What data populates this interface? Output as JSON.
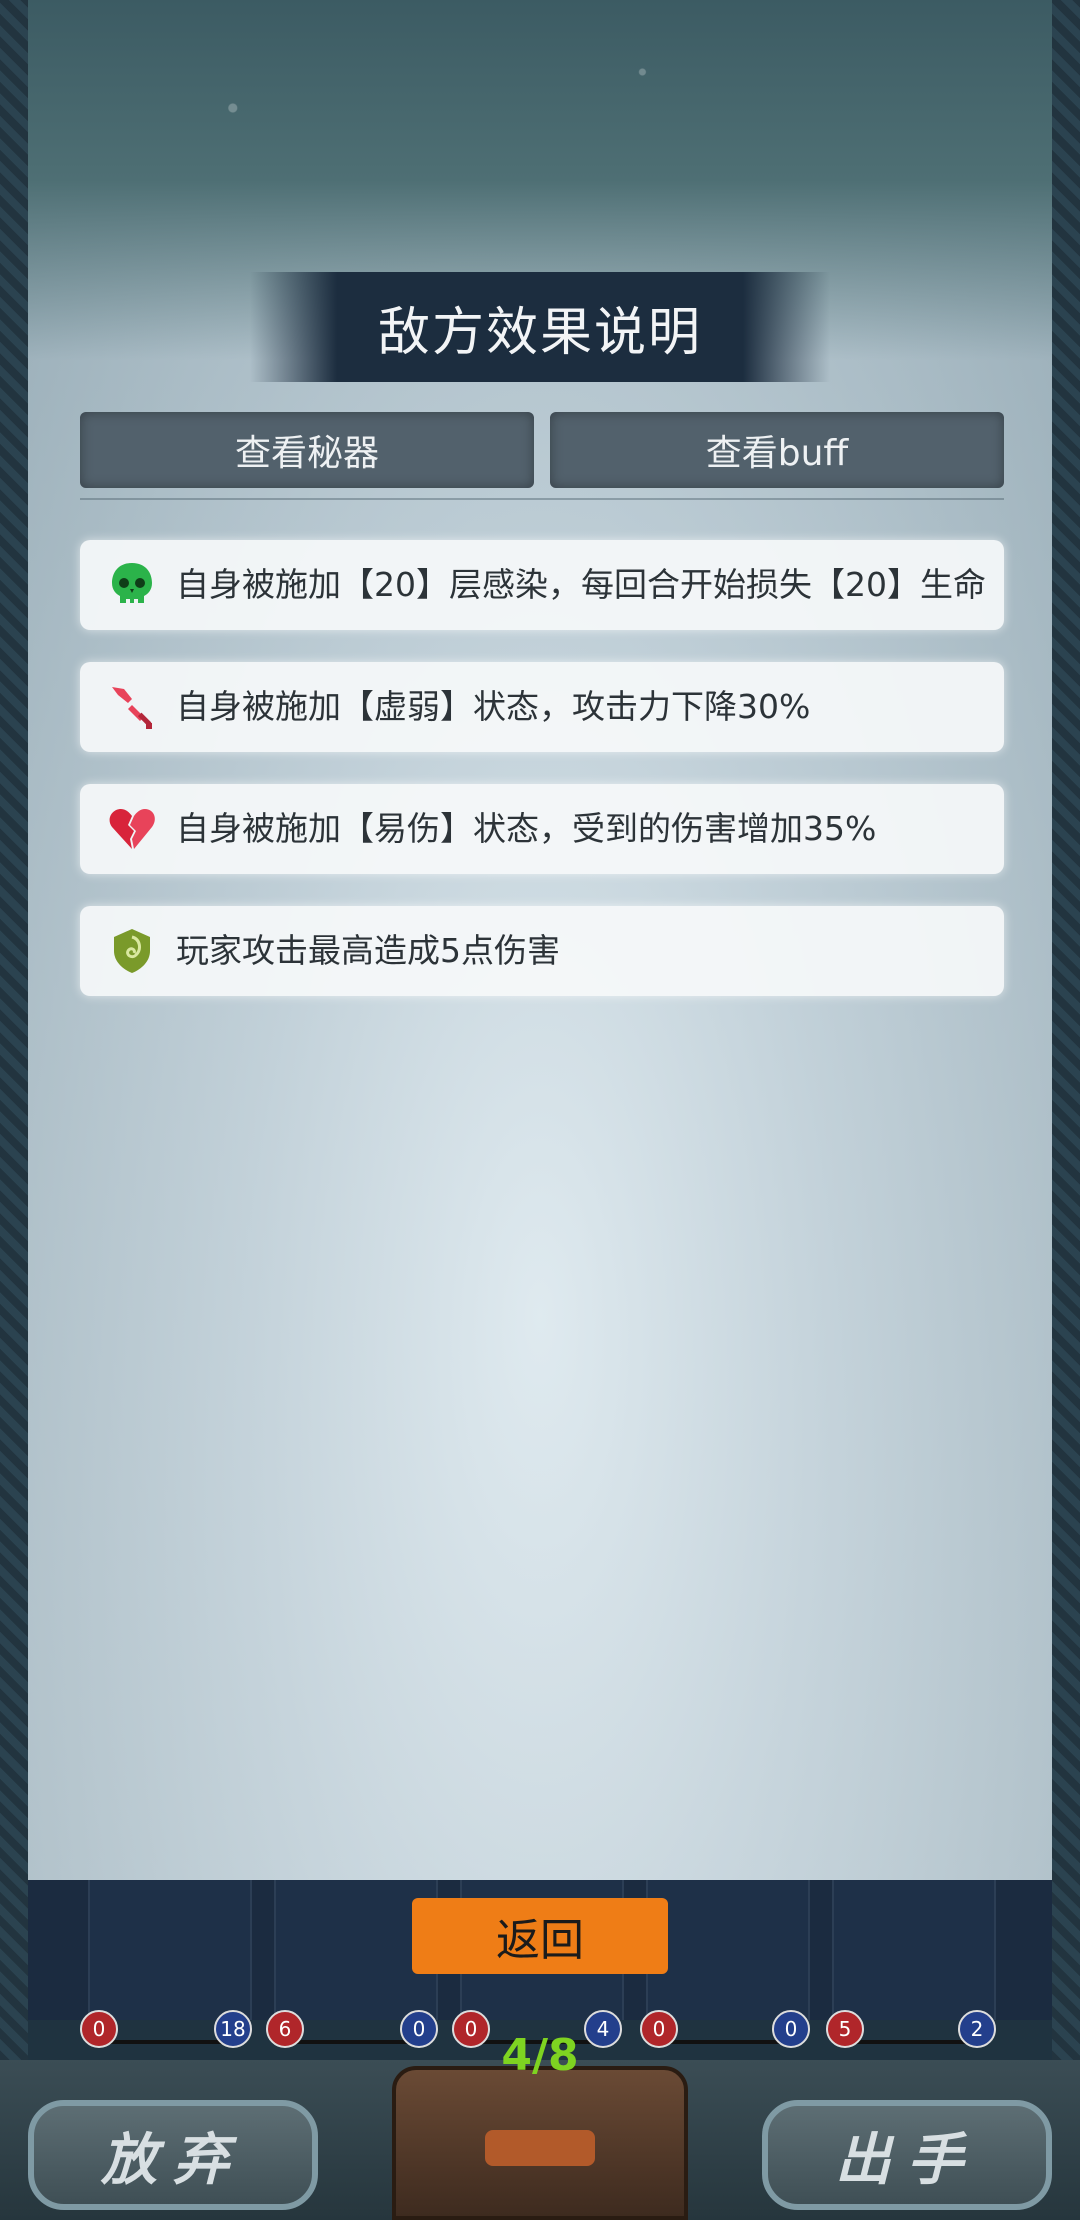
{
  "dialog": {
    "title": "敌方效果说明",
    "tabs": [
      {
        "label": "查看秘器"
      },
      {
        "label": "查看buff"
      }
    ],
    "effects": [
      {
        "icon": "skull-icon",
        "icon_color": "#2bb34a",
        "text": "自身被施加【20】层感染，每回合开始损失【20】生命"
      },
      {
        "icon": "broken-sword-icon",
        "icon_color": "#e8435a",
        "text": "自身被施加【虚弱】状态，攻击力下降30%"
      },
      {
        "icon": "broken-heart-icon",
        "icon_color": "#d8243a",
        "text": "自身被施加【易伤】状态，受到的伤害增加35%"
      },
      {
        "icon": "thorn-shield-icon",
        "icon_color": "#7a9a2a",
        "text": "玩家攻击最高造成5点伤害"
      }
    ],
    "back_label": "返回"
  },
  "track": {
    "badges": [
      {
        "value": "0",
        "color": "red"
      },
      {
        "value": "18",
        "color": "blue"
      },
      {
        "value": "6",
        "color": "red"
      },
      {
        "value": "0",
        "color": "blue"
      },
      {
        "value": "0",
        "color": "red"
      },
      {
        "value": "4",
        "color": "blue"
      },
      {
        "value": "0",
        "color": "red"
      },
      {
        "value": "0",
        "color": "blue"
      },
      {
        "value": "5",
        "color": "red"
      },
      {
        "value": "2",
        "color": "blue"
      }
    ]
  },
  "footer": {
    "discard_label": "放弃",
    "play_label": "出手",
    "deck_count": "4/8"
  },
  "colors": {
    "accent": "#ef7d16",
    "deck_count": "#7ed321"
  }
}
